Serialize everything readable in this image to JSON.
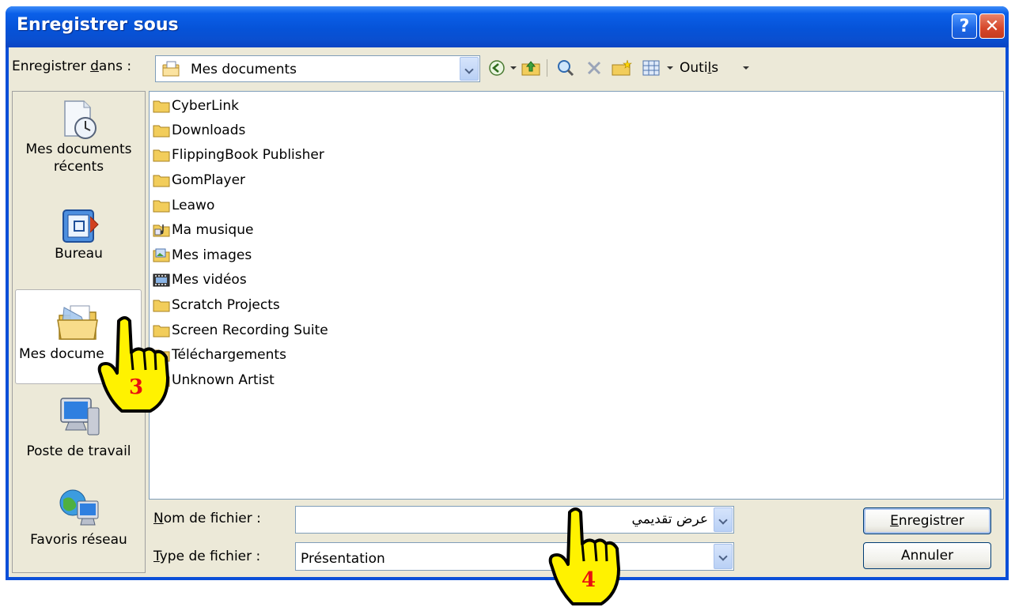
{
  "window": {
    "title": "Enregistrer sous",
    "help_glyph": "?",
    "close_glyph": "✕"
  },
  "top": {
    "save_in_label_pre": "Enregistrer ",
    "save_in_label_accel": "d",
    "save_in_label_post": "ans :",
    "location": "Mes documents",
    "tools_pre": "Outi",
    "tools_accel": "l",
    "tools_post": "s",
    "icons": [
      "back-icon",
      "up-folder-icon",
      "search-web-icon",
      "delete-icon",
      "new-folder-icon",
      "views-icon"
    ]
  },
  "places": {
    "items": [
      {
        "label_line1": "Mes documents",
        "label_line2": "récents",
        "icon": "recent-documents-icon"
      },
      {
        "label_line1": "Bureau",
        "label_line2": "",
        "icon": "desktop-icon"
      },
      {
        "label_line1": "Mes docume",
        "label_line2": "",
        "icon": "my-documents-icon"
      },
      {
        "label_line1": "Poste de travail",
        "label_line2": "",
        "icon": "my-computer-icon"
      },
      {
        "label_line1": "Favoris réseau",
        "label_line2": "",
        "icon": "network-places-icon"
      }
    ]
  },
  "files": [
    {
      "name": "CyberLink",
      "icon": "folder"
    },
    {
      "name": "Downloads",
      "icon": "folder"
    },
    {
      "name": "FlippingBook Publisher",
      "icon": "folder"
    },
    {
      "name": "GomPlayer",
      "icon": "folder"
    },
    {
      "name": "Leawo",
      "icon": "folder"
    },
    {
      "name": "Ma musique",
      "icon": "music-folder"
    },
    {
      "name": "Mes images",
      "icon": "pictures-folder"
    },
    {
      "name": "Mes vidéos",
      "icon": "video-folder"
    },
    {
      "name": "Scratch Projects",
      "icon": "folder"
    },
    {
      "name": "Screen Recording Suite",
      "icon": "folder"
    },
    {
      "name": "Téléchargements",
      "icon": "folder"
    },
    {
      "name": "Unknown Artist",
      "icon": "folder"
    }
  ],
  "bottom": {
    "filename_label_accel": "N",
    "filename_label_rest": "om de fichier :",
    "filename_value": "عرض تقديمي",
    "type_label_accel": "T",
    "type_label_rest": "ype de fichier :",
    "type_value": "Présentation",
    "save_accel": "E",
    "save_rest": "nregistrer",
    "cancel_label": "Annuler"
  },
  "annotations": {
    "step3": "3",
    "step4": "4"
  },
  "colors": {
    "title_bar": "#0653d8",
    "dialog_bg": "#ece9d8",
    "hand_fill": "#fff200",
    "step_number": "#e81010"
  }
}
